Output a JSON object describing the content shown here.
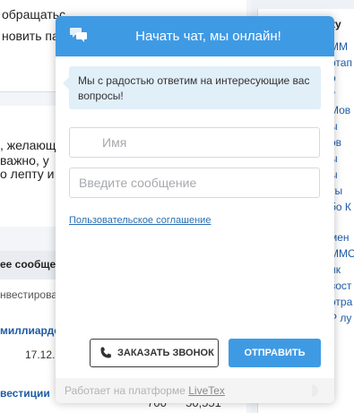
{
  "background": {
    "top_lines": [
      "обращатьс",
      "новить па"
    ],
    "mid_lines": [
      ", желающ",
      "важно, у",
      "о лепту и"
    ],
    "table_header": "ее сообщен",
    "rows": [
      {
        "title": "нвестирова",
        "style": "plain"
      },
      {
        "title": "миллиарде",
        "style": "blue"
      },
      {
        "date": "17.12.",
        "num1": "700",
        "num2": "50,551"
      },
      {
        "title": "вестиции",
        "style": "blue"
      }
    ],
    "right_lines": [
      "ку",
      "ММ",
      "ртап",
      "о",
      "у",
      "Мов",
      "ы",
      "ов",
      "ы",
      "ы",
      "ты",
      "бо К",
      "",
      "мен",
      "ММО",
      "ик",
      "вост",
      "отра",
      "Р лу"
    ]
  },
  "chat": {
    "title": "Начать чат, мы онлайн!",
    "greeting": "Мы с радостью ответим на интересующие вас вопросы!",
    "name_placeholder": "Имя",
    "message_placeholder": "Введите сообщение",
    "agreement_link": "Пользовательское соглашение",
    "call_button": "ЗАКАЗАТЬ ЗВОНОК",
    "send_button": "ОТПРАВИТЬ",
    "footer_text": "Работает на платформе",
    "footer_link": "LiveTex",
    "accent_color": "#3f9ae4",
    "icons": [
      "chat-bubbles-icon",
      "user-icon",
      "phone-icon",
      "livetex-logo-mark"
    ]
  }
}
